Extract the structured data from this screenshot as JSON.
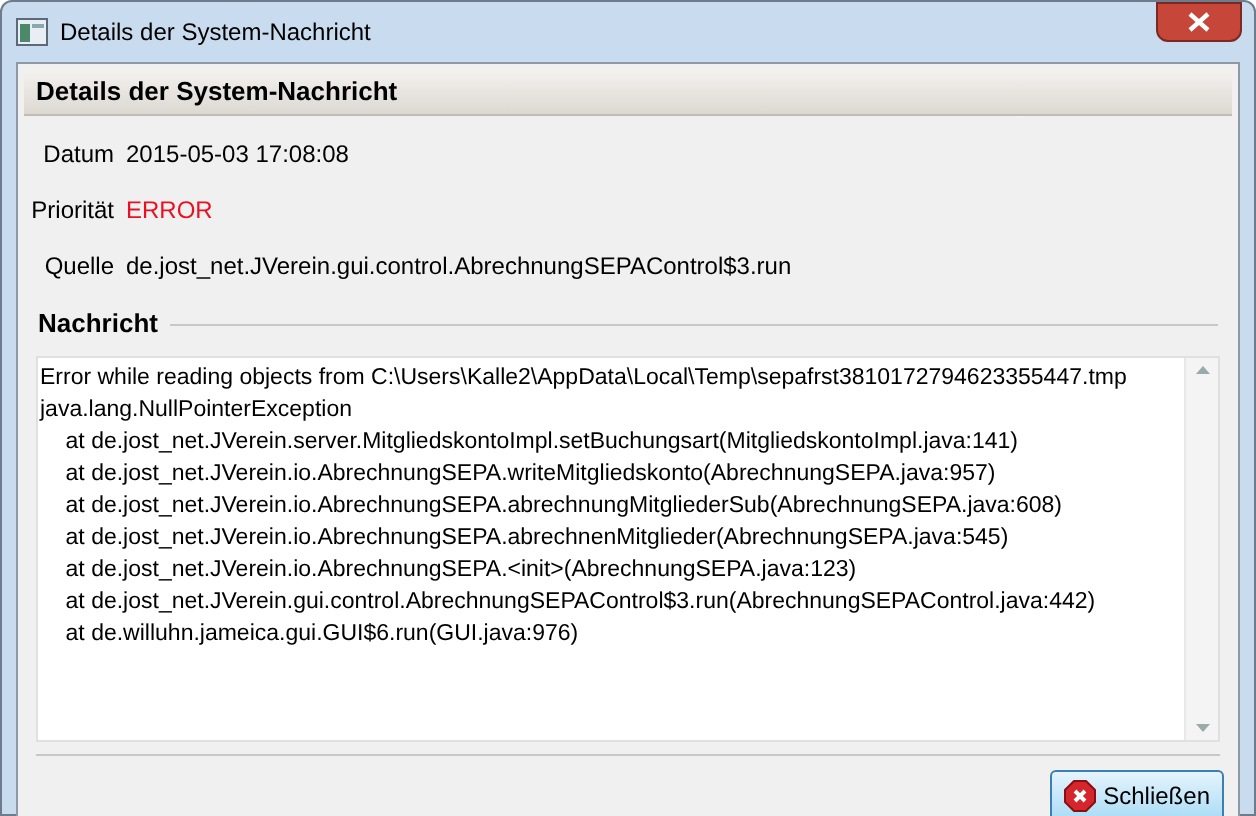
{
  "window": {
    "title": "Details der System-Nachricht"
  },
  "header": "Details der System-Nachricht",
  "fields": [
    {
      "label": "Datum",
      "value": "2015-05-03 17:08:08",
      "kind": "normal"
    },
    {
      "label": "Priorität",
      "value": "ERROR",
      "kind": "error"
    },
    {
      "label": "Quelle",
      "value": "de.jost_net.JVerein.gui.control.AbrechnungSEPAControl$3.run",
      "kind": "normal"
    }
  ],
  "message": {
    "heading": "Nachricht",
    "lines": [
      "Error while reading objects from C:\\Users\\Kalle2\\AppData\\Local\\Temp\\sepafrst3810172794623355447.tmp",
      "java.lang.NullPointerException",
      "    at de.jost_net.JVerein.server.MitgliedskontoImpl.setBuchungsart(MitgliedskontoImpl.java:141)",
      "    at de.jost_net.JVerein.io.AbrechnungSEPA.writeMitgliedskonto(AbrechnungSEPA.java:957)",
      "    at de.jost_net.JVerein.io.AbrechnungSEPA.abrechnungMitgliederSub(AbrechnungSEPA.java:608)",
      "    at de.jost_net.JVerein.io.AbrechnungSEPA.abrechnenMitglieder(AbrechnungSEPA.java:545)",
      "    at de.jost_net.JVerein.io.AbrechnungSEPA.<init>(AbrechnungSEPA.java:123)",
      "    at de.jost_net.JVerein.gui.control.AbrechnungSEPAControl$3.run(AbrechnungSEPAControl.java:442)",
      "    at de.willuhn.jameica.gui.GUI$6.run(GUI.java:976)"
    ]
  },
  "buttons": [
    {
      "label": "Schließen"
    }
  ]
}
